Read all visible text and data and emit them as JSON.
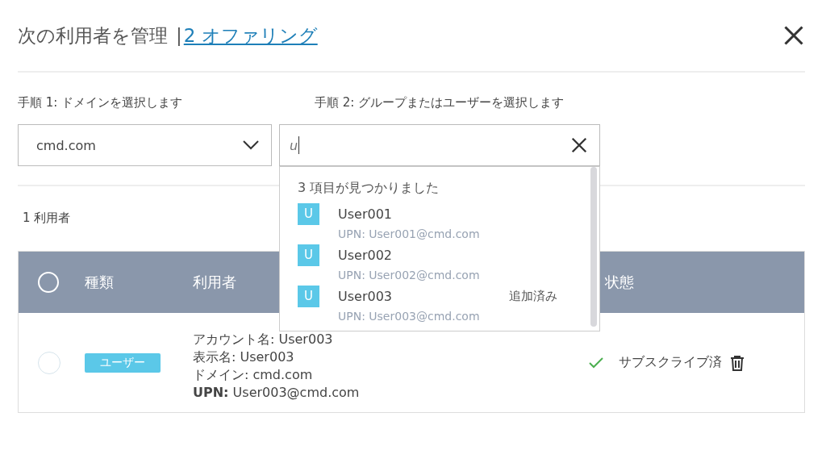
{
  "header": {
    "title": "次の利用者を管理",
    "separator": "|",
    "link": "2 オファリング"
  },
  "steps": [
    {
      "label": "手順 1: ドメインを選択します",
      "kind": "select",
      "value": "cmd.com"
    },
    {
      "label": "手順 2: グループまたはユーザーを選択します",
      "kind": "search",
      "value": "u"
    }
  ],
  "results": {
    "count_text": "3 項目が見つかりました",
    "items": [
      {
        "badge": "U",
        "name": "User001",
        "upn": "UPN: User001@cmd.com"
      },
      {
        "badge": "U",
        "name": "User002",
        "upn": "UPN: User002@cmd.com"
      },
      {
        "badge": "U",
        "name": "User003",
        "upn": "UPN: User003@cmd.com",
        "note": "追加済み"
      }
    ]
  },
  "user_count": "1 利用者",
  "table": {
    "select_all_checked": false,
    "columns": [
      "種類",
      "利用者",
      "状態"
    ],
    "rows": [
      {
        "checked": false,
        "type": "ユーザー",
        "details": [
          "アカウント名: User003",
          "表示名: User003",
          "ドメイン: cmd.com",
          "**UPN:** User003@cmd.com"
        ],
        "status": "サブスクライブ済"
      }
    ]
  }
}
